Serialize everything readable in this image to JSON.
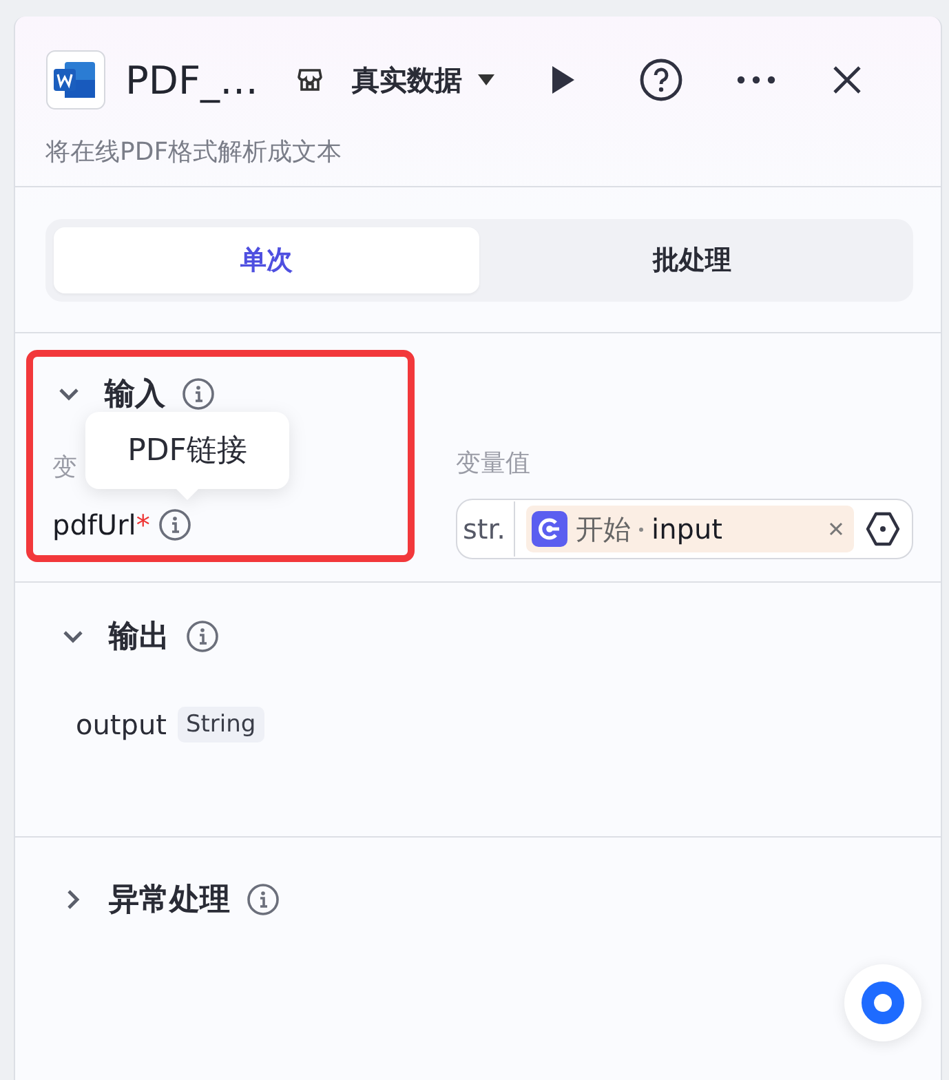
{
  "header": {
    "title": "PDF_…",
    "mode": "真实数据",
    "description": "将在线PDF格式解析成文本"
  },
  "tabs": [
    {
      "label": "单次",
      "selected": true
    },
    {
      "label": "批处理",
      "selected": false
    }
  ],
  "input": {
    "title": "输入",
    "expanded": true,
    "highlighted": true,
    "name_label": "变",
    "value_label": "变量值",
    "params": [
      {
        "name": "pdfUrl",
        "required_mark": "*",
        "tooltip": "PDF链接",
        "type": "str.",
        "source": "开始",
        "variable": "input"
      }
    ]
  },
  "output": {
    "title": "输出",
    "expanded": true,
    "fields": [
      {
        "name": "output",
        "type": "String"
      }
    ]
  },
  "exception": {
    "title": "异常处理",
    "expanded": false
  }
}
